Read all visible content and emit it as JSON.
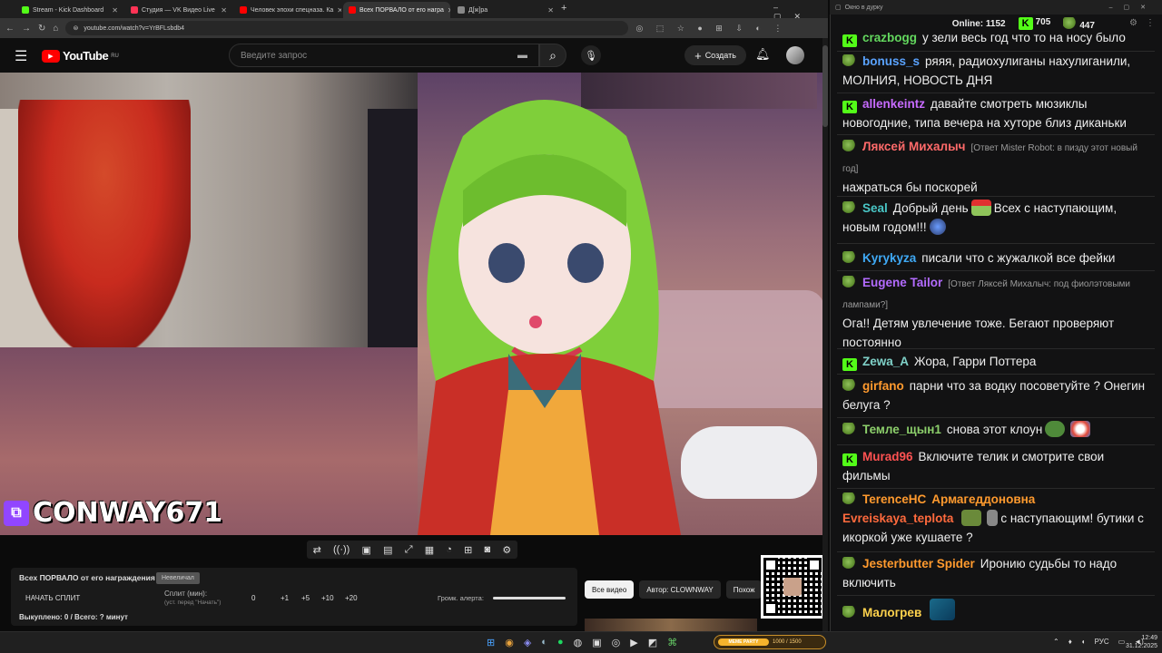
{
  "browser": {
    "tabs": [
      {
        "label": "Stream - Kick Dashboard",
        "color": "#53fc18"
      },
      {
        "label": "Студия — VK Видео Live",
        "color": "#ff3355"
      },
      {
        "label": "Человек эпохи спецназа. Ка",
        "color": "#ff0000"
      },
      {
        "label": "Всех ПОРВАЛО от его награ",
        "color": "#ff0000"
      },
      {
        "label": "Д[ж]ра",
        "color": "#888888"
      }
    ],
    "url": "youtube.com/watch?v=YrBFLsbdb4"
  },
  "youtube": {
    "logo": "YouTube",
    "region": "RU",
    "search_placeholder": "Введите запрос",
    "create_label": "Создать"
  },
  "video": {
    "streamer": "CONWAY671"
  },
  "alert_panel": {
    "title": "Всех ПОРВАЛО от его награждения",
    "status_badge": "Невеличал",
    "start_split": "НАЧАТЬ СПЛИТ",
    "split_label": "Сплит (мин):",
    "split_hint": "(уст. перед \"Начать\")",
    "split_value": "0",
    "increments": [
      "+1",
      "+5",
      "+10",
      "+20"
    ],
    "alert_volume_label": "Громк. алерта:",
    "summary": "Выкуплено: 0 / Всего: ? минут"
  },
  "chips": [
    "Все видео",
    "Автор: CLOWNWAY",
    "Похож"
  ],
  "chat_window": {
    "title": "Окно в дурку",
    "online_label": "Online:",
    "online_count": "1152",
    "kick_count": "705",
    "pepe_count": "447"
  },
  "chat": [
    {
      "badge": "kick",
      "user": "crazbogg",
      "color": "#63d85e",
      "text": "у зели весь год что то на носу было"
    },
    {
      "badge": "pepe",
      "user": "bonuss_s",
      "color": "#5aa3ff",
      "text": "ряяя, радиохулиганы нахулиганили, МОЛНИЯ, НОВОСТЬ ДНЯ"
    },
    {
      "badge": "kick",
      "user": "allenkeintz",
      "color": "#c76bff",
      "text": "давайте смотреть мюзиклы новогодние, типа вечера на хуторе близ диканьки"
    },
    {
      "badge": "pepe",
      "user": "Ляксей Михалыч",
      "color": "#ff6a6a",
      "reply": "[Ответ Mister Robot: в пизду этот новый год]",
      "text": "нажраться бы поскорей"
    },
    {
      "badge": "pepe",
      "user": "Seal",
      "color": "#49c6c6",
      "text": "Добрый день",
      "text2": "Всех с наступающим, новым годом!!!"
    },
    {
      "badge": "pepe",
      "user": "Kyrykyza",
      "color": "#3fa9f5",
      "text": "писали что с жужалкой все фейки"
    },
    {
      "badge": "pepe",
      "user": "Eugene Tailor",
      "color": "#b36bff",
      "reply": "[Ответ Ляксей Михалыч: под фиолэтовыми лампами?]",
      "text": "Ога!! Детям увлечение тоже. Бегают проверяют постоянно"
    },
    {
      "badge": "kick",
      "user": "Zewa_A",
      "color": "#7fd1c8",
      "text": "Жора, Гарри Поттера"
    },
    {
      "badge": "pepe",
      "user": "girfano",
      "color": "#ff9a2e",
      "text": "парни что за водку посоветуйте ? Онегин белуга ?"
    },
    {
      "badge": "pepe",
      "user": "Темле_щын1",
      "color": "#8ccf6b",
      "text": "снова этот клоун"
    },
    {
      "badge": "kick",
      "user": "Murad96",
      "color": "#ff5252",
      "text": "Включите телик и смотрите свои фильмы"
    },
    {
      "badge": "pepe",
      "user": "TerenceHC",
      "color": "#ff9a2e",
      "user2": "Армагеддоновна",
      "color2": "#ff9a2e"
    },
    {
      "badge": "",
      "user": "Evreiskaya_teplota",
      "color": "#ff6a3d",
      "text": "с наступающим! бутики с икоркой уже кушаете ?"
    },
    {
      "badge": "pepe",
      "user": "Jesterbutter Spider",
      "color": "#ff9a2e",
      "text": "Иронию судьбы то надо включить"
    },
    {
      "badge": "pepe",
      "user": "Малогрев",
      "color": "#ffd34d",
      "text": ""
    }
  ],
  "taskbar": {
    "lang": "РУС",
    "time": "12:49",
    "date": "31.12.2025",
    "widget": "MEME PARTY",
    "widget_progress": "1000 / 1500"
  }
}
